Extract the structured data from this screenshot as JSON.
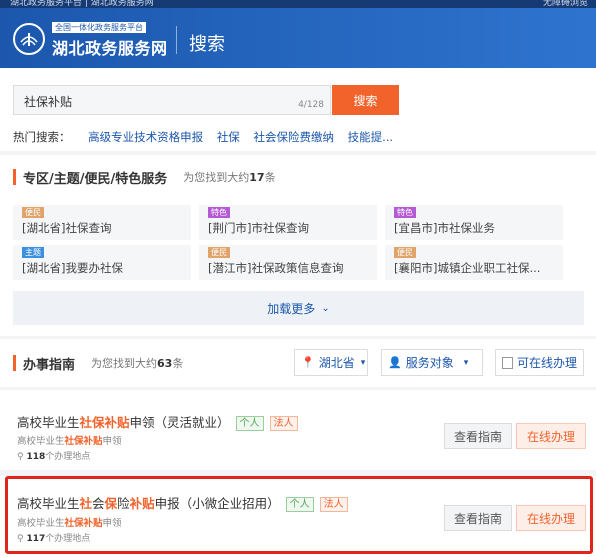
{
  "topbar": {
    "left_text": "湖北政务服务平台 | 湖北政务服务网",
    "right_text": "无障碍浏览"
  },
  "header": {
    "logo_small": "全国一体化政务服务平台",
    "logo_title": "湖北政务服务网",
    "page_title": "搜索"
  },
  "search": {
    "value": "社保补贴",
    "count": "4/128",
    "button_label": "搜索"
  },
  "hot": {
    "label": "热门搜索：",
    "keywords": [
      "高级专业技术资格申报",
      "社保",
      "社会保险费缴纳",
      "技能提..."
    ]
  },
  "special": {
    "title": "专区/主题/便民/特色服务",
    "found_prefix": "为您找到大约",
    "found_count": "17",
    "found_suffix": "条",
    "cards": [
      {
        "tag": "便民",
        "tag_color": "#e0a36a",
        "title": "[湖北省]社保查询"
      },
      {
        "tag": "特色",
        "tag_color": "#b45ad4",
        "title": "[荆门市]市社保查询"
      },
      {
        "tag": "特色",
        "tag_color": "#b45ad4",
        "title": "[宜昌市]市社保业务"
      },
      {
        "tag": "主题",
        "tag_color": "#3d8fe0",
        "title": "[湖北省]我要办社保"
      },
      {
        "tag": "便民",
        "tag_color": "#e0a36a",
        "title": "[潜江市]社保政策信息查询"
      },
      {
        "tag": "便民",
        "tag_color": "#e0a36a",
        "title": "[襄阳市]城镇企业职工社保..."
      }
    ],
    "load_more": "加载更多"
  },
  "guide": {
    "title": "办事指南",
    "found_prefix": "为您找到大约",
    "found_count": "63",
    "found_suffix": "条",
    "filter_region": "湖北省",
    "filter_target": "服务对象",
    "filter_online": "可在线办理",
    "items": [
      {
        "title_parts": [
          "高校毕业生",
          "社保补贴",
          "申领（灵活就业）"
        ],
        "tags": [
          "个人",
          "法人"
        ],
        "sub_parts": [
          "高校毕业生",
          "社保补贴",
          "申领"
        ],
        "loc_count": "118",
        "loc_suffix": "个办理地点",
        "btn_guide": "查看指南",
        "btn_online": "在线办理"
      },
      {
        "title_parts": [
          "高校毕业生",
          "社",
          "会",
          "保",
          "险",
          "补贴",
          "申报（小微企业招用）"
        ],
        "tags": [
          "个人",
          "法人"
        ],
        "sub_parts": [
          "高校毕业生",
          "社保补贴",
          "申领"
        ],
        "loc_count": "117",
        "loc_suffix": "个办理地点",
        "btn_guide": "查看指南",
        "btn_online": "在线办理"
      }
    ]
  },
  "colors": {
    "brand_blue": "#1c57ad",
    "accent_orange": "#f2632c",
    "highlight_red": "#e0251b"
  }
}
